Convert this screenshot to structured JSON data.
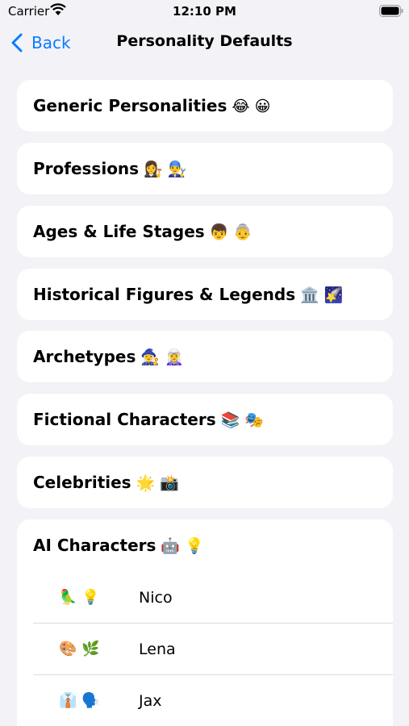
{
  "status_bar": {
    "carrier": "Carrier",
    "time": "12:10 PM"
  },
  "nav": {
    "back_label": "Back",
    "title": "Personality Defaults"
  },
  "categories": [
    {
      "label": "Generic Personalities",
      "emojis": "😂 😀"
    },
    {
      "label": "Professions",
      "emojis": "👩‍⚖️ 👨‍🔧"
    },
    {
      "label": "Ages & Life Stages",
      "emojis": "👦 👵"
    },
    {
      "label": "Historical Figures & Legends",
      "emojis": "🏛️ 🌠"
    },
    {
      "label": "Archetypes",
      "emojis": "🧙‍♀️ 🧝‍♀️"
    },
    {
      "label": "Fictional Characters",
      "emojis": "📚 🎭"
    },
    {
      "label": "Celebrities",
      "emojis": "🌟 📸"
    }
  ],
  "ai_section": {
    "label": "AI Characters",
    "emojis": "🤖 💡",
    "characters": [
      {
        "emojis": "🦜 💡",
        "name": "Nico"
      },
      {
        "emojis": "🎨 🌿",
        "name": "Lena"
      },
      {
        "emojis": "👔 🗣️",
        "name": "Jax"
      }
    ]
  }
}
